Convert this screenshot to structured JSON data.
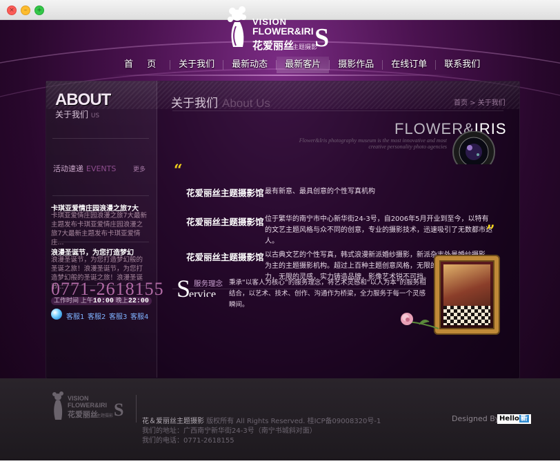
{
  "window": {
    "controls": [
      "×",
      "–",
      "+"
    ]
  },
  "logo": {
    "line1": "VISION",
    "line2": "FLOWER&IRI",
    "line_s": "S",
    "line3": "花爱丽丝",
    "line4": "主题摄影"
  },
  "nav": {
    "items": [
      "首 页",
      "关于我们",
      "最新动态",
      "最新客片",
      "摄影作品",
      "在线订单",
      "联系我们"
    ]
  },
  "sidebar": {
    "about_big": "ABOUT",
    "about_cn": "关于我们",
    "about_small": "US",
    "events_title": "活动速递",
    "events_en": "EVENTS",
    "more": "更多",
    "events": [
      {
        "title": "卡琪亚爱情庄园浪漫之旅7大",
        "text": "卡琪亚爱情庄园浪漫之旅7大最新主题发布卡琪亚爱情庄园浪漫之旅7大最新主题发布卡琪亚爱情庄..."
      },
      {
        "title": "浪漫圣诞节，为您打造梦幻",
        "text": "浪漫圣诞节，为您打造梦幻般的圣诞之旅！浪漫圣诞节，为您打造梦幻般的圣诞之旅！浪漫圣诞节..."
      }
    ],
    "phone": "0771-2618155",
    "hours_label": "工作时间",
    "hours_am": "上午",
    "hours_open": "10:00",
    "hours_pm": "晚上",
    "hours_close": "22:00",
    "services": [
      "客服1",
      "客服2",
      "客服3",
      "客服4"
    ]
  },
  "content": {
    "title_cn": "关于我们",
    "title_en": "About Us",
    "breadcrumb": "首页  >  关于我们",
    "brand_a": "FLOWER&",
    "brand_b": "IRIS",
    "brand_sub": "Flower&Iris photography museum is the most innovative and most creative personality photo agencies",
    "quote_open": "“",
    "quote_close": "”",
    "rows": [
      {
        "heading": "花爱丽丝主题摄影馆",
        "text": "最有新意、最具创意的个性写真机构"
      },
      {
        "heading": "花爱丽丝主题摄影馆",
        "text": "位于繁华的南宁市中心新华街24-3号，自2006年5月开业到至今，以特有的文艺主题风格与众不同的创意，专业的摄影技术，迅速吸引了无数都市达人。"
      },
      {
        "heading": "花爱丽丝主题摄影馆",
        "text": "以古典文艺的个性写真，韩式浪漫新派婚纱摄影，新派杂志外景婚纱摄影为主的主题摄影机构。超过上百种主题创意风格，无限的视觉，无限的潜力，无限的灵感，实力铸造品牌，影像艺术锐不可挡。"
      }
    ],
    "service": {
      "big_S": "S",
      "ervice": "ervice",
      "label_cn": "服务理念",
      "text": "秉承“以客人为核心”的服务理念，将艺术灵感和“以人为本”的服务相结合，以艺术、技术、创作、沟通作为桥梁，全力服务于每一个灵感瞬间。"
    }
  },
  "footer": {
    "logo_line1": "VISION",
    "logo_line2": "FLOWER&IRI",
    "logo_s": "S",
    "logo_line3": "花爱丽丝",
    "logo_line4": "主题摄影",
    "line1_brand": "花＆爱丽丝主题摄影",
    "line1_rest": "版权所有 All Rights Reserved. 桂ICP备09008320号-1",
    "line2": "我们的地址：广西南宁新华街24-3号（南宁书城斜对面）",
    "line3": "我们的电话：0771-2618155",
    "designed_by": "Designed By",
    "hello": "Hello",
    "hello_box": "新"
  }
}
